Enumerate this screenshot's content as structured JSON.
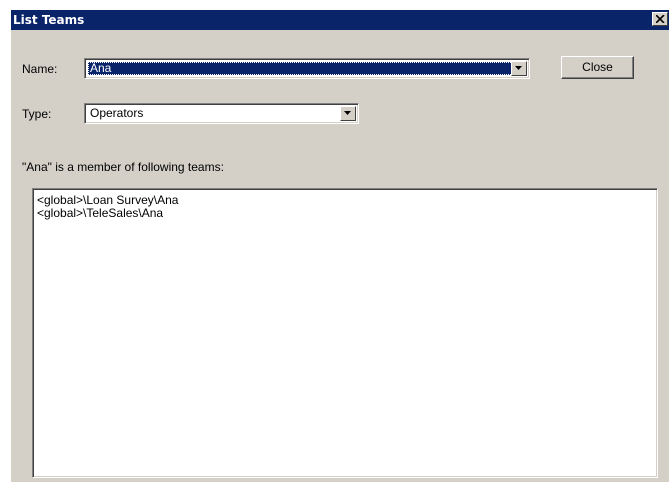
{
  "window": {
    "title": "List Teams",
    "close_glyph": "✕"
  },
  "name_field": {
    "label": "Name:",
    "value": "Ana"
  },
  "type_field": {
    "label": "Type:",
    "value": "Operators"
  },
  "close_button": {
    "label": "Close"
  },
  "membership": {
    "caption": "\"Ana\" is a member of following teams:",
    "teams": [
      "<global>\\Loan Survey\\Ana",
      "<global>\\TeleSales\\Ana"
    ]
  },
  "icons": {
    "window_close": "close-icon",
    "dropdown": "chevron-down-icon"
  },
  "colors": {
    "titlebar": "#0a246a",
    "face": "#d4d0c8",
    "selection": "#0a246a"
  }
}
